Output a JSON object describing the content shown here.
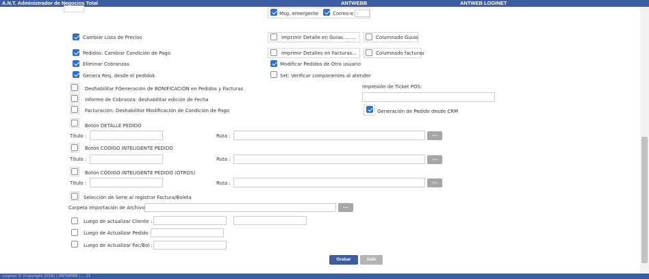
{
  "header": {
    "title": "A.N.T. Administrador de Negocios Total",
    "db_name": "ANTWEBB",
    "user_name": "ANTWEB LOGINET"
  },
  "footer": {
    "text": "Loginet © (Copyright 2016) | ANTWEBB | ... 21"
  },
  "options": {
    "msg_emergente": {
      "label": "Msg. emergente",
      "checked": true
    },
    "correo_e": {
      "label": "Correo-e",
      "value": ":",
      "checked": true
    },
    "cambiar_lista_precios": {
      "label": "Cambiar Lista de Precios",
      "checked": true
    },
    "imprimir_detalle_guias": {
      "label": "Imprimir Detalle en Guias.........",
      "checked": false
    },
    "columnado_guias": {
      "label": "Columnado Guias",
      "checked": false
    },
    "pedidos_cambiar_condicion": {
      "label": "Pedidos: Cambiar Condición de Pago",
      "checked": true
    },
    "imprimir_detalles_facturas": {
      "label": "Imprimir Detalles en Facturas...",
      "checked": false
    },
    "columnado_facturas": {
      "label": "Columnado facturas",
      "checked": false
    },
    "eliminar_cobranzas": {
      "label": "Eliminar Cobranzas",
      "checked": true
    },
    "modificar_pedidos_otro_usuario": {
      "label": "Modificar Pedidos de Otro usuario",
      "checked": true
    },
    "genera_req": {
      "label": "Genera Req. desde el pedidok",
      "checked": true
    },
    "set_verificar": {
      "label": "Set: Verificar componentes al atender",
      "checked": false
    },
    "deshabilitar_bonificacion": {
      "label": "Deshabilitar FGeneración de BONIFICACIÓN en Pedidos y Facturas",
      "checked": false
    },
    "informe_cobranza": {
      "label": "Informe de Cobranza: deshabilitar edición de Fecha",
      "checked": false
    },
    "facturacion_deshabilitar": {
      "label": "Facturación: Deshabilitar Modificación de Condición de Pago",
      "checked": false
    },
    "generacion_pedido_crm": {
      "label": "Generación de Pedido desde CRM",
      "checked": true
    }
  },
  "ticket_pos": {
    "label": "Impresión de Ticket POS:",
    "value": ""
  },
  "boton_detalle": {
    "label": "Botón DETALLE PEDIDO",
    "checked": false,
    "titulo_label": "Título :",
    "titulo_value": "",
    "ruta_label": "Ruta :",
    "ruta_value": "",
    "browse_label": "..."
  },
  "boton_codigo": {
    "label": "Botón CODIGO INTELIGENTE PEDIDO",
    "checked": false,
    "titulo_label": "Título :",
    "titulo_value": "",
    "ruta_label": "Ruta :",
    "ruta_value": "",
    "browse_label": "..."
  },
  "boton_codigo_otros": {
    "label": "Botón CÓDIGO INTELIGENTE PEDIDO (OTROS)",
    "checked": false,
    "titulo_label": "Título :",
    "titulo_value": "",
    "ruta_label": "Ruta :",
    "ruta_value": "",
    "browse_label": "..."
  },
  "seleccion_serie": {
    "label": "Selección de Serie al registrar Factura/Boleta",
    "checked": false
  },
  "carpeta_importacion": {
    "label": "Carpeta Importación de Archivos",
    "value": "",
    "browse_label": "..."
  },
  "luego_cliente": {
    "label": "Luego de actualizar Cliente :",
    "checked": false,
    "value": "",
    "value2": ""
  },
  "luego_pedido": {
    "label": "Luego de Actualizar Pedido :",
    "checked": false,
    "value": ""
  },
  "luego_facbol": {
    "label": "Luego de Actualizar Fac/Bol :",
    "checked": false,
    "value": ""
  },
  "actions": {
    "save_label": "Grabar",
    "exit_label": "Salir"
  },
  "colors": {
    "header_bg": "#3d5da3",
    "checkbox_checked": "#2b6fd6",
    "browse_button": "#a6a6a6",
    "exit_button": "#b3b3b3"
  }
}
